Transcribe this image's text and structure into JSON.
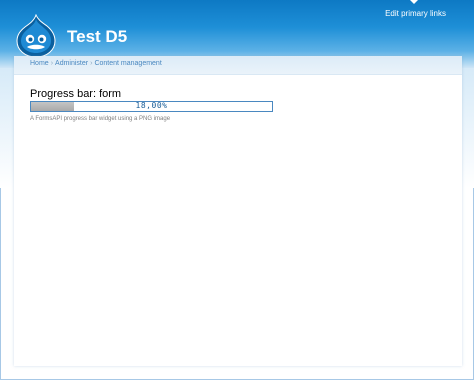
{
  "header": {
    "site_name": "Test D5",
    "primary_links_label": "Edit primary links"
  },
  "breadcrumb": [
    "Home",
    "Administer",
    "Content management"
  ],
  "page": {
    "title": "Progress bar: form",
    "progress": {
      "value_percent": 18.0,
      "label": "18,00%"
    },
    "description": "A FormsAPI progress bar widget using a PNG image"
  },
  "colors": {
    "header_blue": "#1e8fd7",
    "link": "#4a88c0",
    "progress_fill": "#b0b0b0"
  },
  "icons": {
    "logo": "drupal-drop-logo-icon"
  }
}
